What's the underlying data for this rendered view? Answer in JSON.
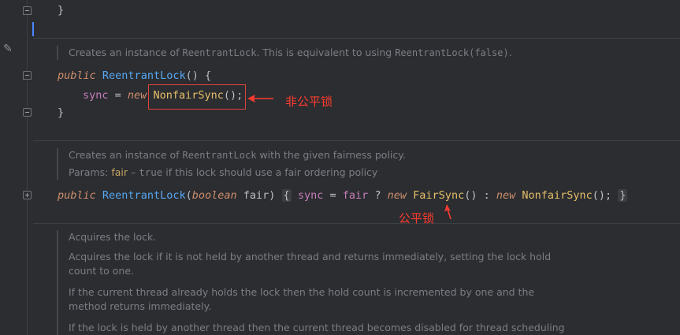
{
  "editor": {
    "top_brace": "}",
    "doc1": {
      "pre": "Creates an instance of ",
      "code1": "ReentrantLock",
      "mid": ". This is equivalent to using ",
      "code2": "ReentrantLock(false)",
      "post": "."
    },
    "ctor1": {
      "kw_public": "public",
      "name": "ReentrantLock",
      "sig": "() {",
      "field": "sync",
      "eq": " = ",
      "kw_new": "new",
      "cls": "NonfairSync",
      "call": "();",
      "close": "}"
    },
    "doc2": {
      "pre": "Creates an instance of ",
      "code1": "ReentrantLock",
      "post": " with the given fairness policy.",
      "params_label": "Params: ",
      "param_name": "fair",
      "dash": " – ",
      "param_true": "true",
      "param_desc": " if this lock should use a fair ordering policy"
    },
    "ctor2": {
      "kw_public": "public",
      "name": "ReentrantLock",
      "paren_open": "(",
      "kw_boolean": "boolean",
      "param": " fair",
      "paren_close": ") ",
      "brace_open": "{",
      "field": "sync",
      "eq": " = ",
      "param_ref": "fair",
      "q": " ? ",
      "kw_new1": "new",
      "cls1": "FairSync",
      "call1": "() : ",
      "kw_new2": "new",
      "cls2": "NonfairSync",
      "call2": "();",
      "brace_close": "}"
    },
    "doc3": {
      "line1": "Acquires the lock.",
      "line2": "Acquires the lock if it is not held by another thread and returns immediately, setting the lock hold",
      "line3": "count to one.",
      "line4": "If the current thread already holds the lock then the hold count is incremented by one and the",
      "line5": "method returns immediately.",
      "line6": "If the lock is held by another thread then the current thread becomes disabled for thread scheduling"
    }
  },
  "annotations": {
    "nonfair_label": "非公平锁",
    "fair_label": "公平锁",
    "color": "#ff3b30"
  }
}
